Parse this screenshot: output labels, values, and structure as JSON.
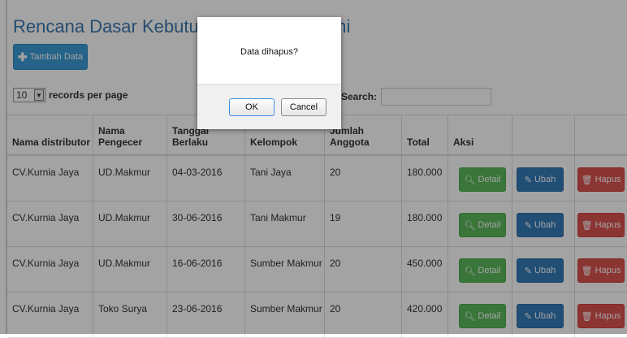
{
  "page": {
    "title": "Rencana Dasar Kebutuhan Kelompok Tani"
  },
  "toolbar": {
    "add_label": "Tambah Data"
  },
  "length_menu": {
    "value": "10",
    "suffix": "records per page"
  },
  "search": {
    "label": "Search:",
    "value": ""
  },
  "table": {
    "columns": [
      {
        "label": "Nama distributor"
      },
      {
        "label": "Nama Pengecer"
      },
      {
        "label": "Tanggal Berlaku"
      },
      {
        "label": "Kelompok"
      },
      {
        "label": "Jumlah Anggota"
      },
      {
        "label": "Total"
      },
      {
        "label": "Aksi"
      },
      {
        "label": ""
      },
      {
        "label": ""
      }
    ],
    "rows": [
      {
        "distributor": "CV.Kurnia Jaya",
        "pengecer": "UD.Makmur",
        "tanggal": "04-03-2016",
        "kelompok": "Tani Jaya",
        "anggota": "20",
        "total": "180.000"
      },
      {
        "distributor": "CV.Kurnia Jaya",
        "pengecer": "UD.Makmur",
        "tanggal": "30-06-2016",
        "kelompok": "Tani Makmur",
        "anggota": "19",
        "total": "180.000"
      },
      {
        "distributor": "CV.Kurnia Jaya",
        "pengecer": "UD.Makmur",
        "tanggal": "16-06-2016",
        "kelompok": "Sumber Makmur",
        "anggota": "20",
        "total": "450.000"
      },
      {
        "distributor": "CV.Kurnia Jaya",
        "pengecer": "Toko Surya",
        "tanggal": "23-06-2016",
        "kelompok": "Sumber Makmur",
        "anggota": "20",
        "total": "420.000"
      }
    ],
    "actions": {
      "detail": "Detail",
      "ubah": "Ubah",
      "hapus": "Hapus"
    }
  },
  "dialog": {
    "message": "Data dihapus?",
    "ok": "OK",
    "cancel": "Cancel"
  },
  "colors": {
    "detail": "#5cb85c",
    "ubah": "#337ab7",
    "hapus": "#d9534f",
    "add": "#3a9bd6",
    "title": "#3c78b0"
  },
  "icons": {
    "add": "plus-icon",
    "detail": "search-icon",
    "ubah": "edit-icon",
    "hapus": "trash-icon",
    "dropdown": "chevron-down-icon"
  }
}
